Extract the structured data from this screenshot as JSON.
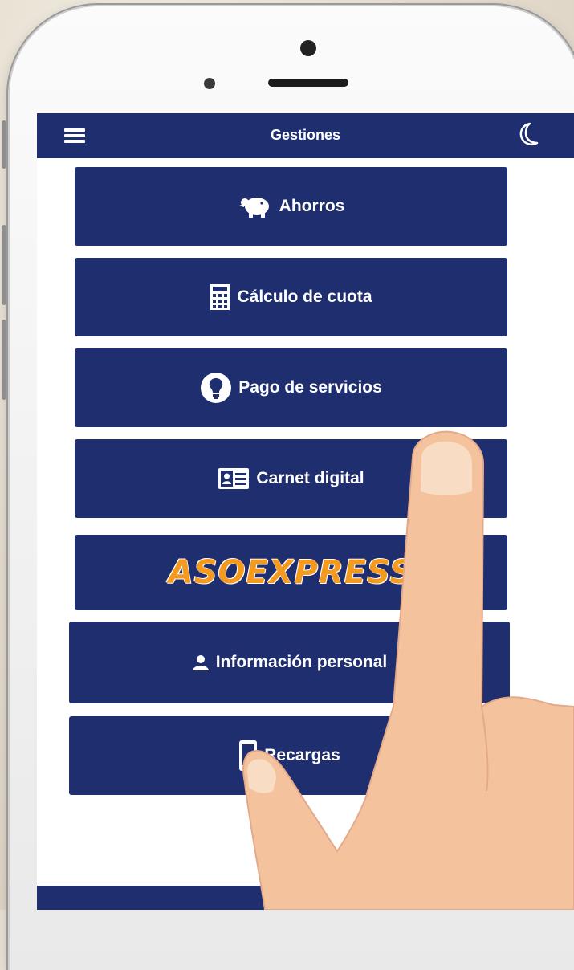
{
  "header": {
    "title": "Gestiones",
    "menu_icon": "hamburger-menu-icon",
    "theme_icon": "moon-icon"
  },
  "menu": [
    {
      "label": "Ahorros",
      "icon": "piggy-bank-icon"
    },
    {
      "label": "Cálculo de cuota",
      "icon": "calculator-icon"
    },
    {
      "label": "Pago de servicios",
      "icon": "lightbulb-icon"
    },
    {
      "label": "Carnet digital",
      "icon": "id-card-icon"
    },
    {
      "logo_text": "ASOEXPRESS",
      "icon": "asoexpress-logo"
    },
    {
      "label": "Información personal",
      "icon": "person-icon"
    },
    {
      "label": "Recargas",
      "icon": "phone-icon"
    }
  ],
  "colors": {
    "primary": "#1f2e6e",
    "accent": "#f39a1f",
    "skin": "#f4c39e"
  }
}
